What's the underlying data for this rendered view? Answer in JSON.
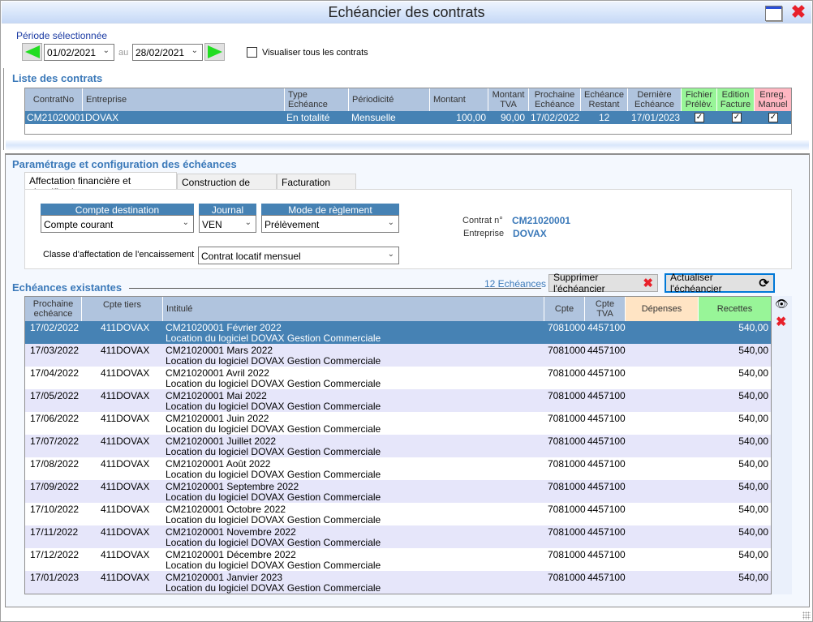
{
  "window": {
    "title": "Echéancier des contrats",
    "restore_icon": "window-restore-icon",
    "close_icon": "close-icon"
  },
  "period": {
    "label": "Période sélectionnée",
    "from": "01/02/2021",
    "to_label": "au",
    "to": "28/02/2021",
    "show_all_label": "Visualiser tous les contrats",
    "show_all_checked": false
  },
  "contracts": {
    "title": "Liste des contrats",
    "columns": [
      "ContratNo",
      "Entreprise",
      "Type Echéance",
      "Périodicité",
      "Montant",
      "Montant TVA",
      "Prochaine Echéance",
      "Echéance Restant",
      "Dernière Echéance",
      "Fichier Prélèv.",
      "Edition Facture",
      "Enreg. Manuel"
    ],
    "column_lines": [
      [
        "ContratNo"
      ],
      [
        "Entreprise"
      ],
      [
        "Type",
        "Echéance"
      ],
      [
        "Périodicité"
      ],
      [
        "Montant"
      ],
      [
        "Montant",
        "TVA"
      ],
      [
        "Prochaine",
        "Echéance"
      ],
      [
        "Echéance",
        "Restant"
      ],
      [
        "Dernière",
        "Echéance"
      ],
      [
        "Fichier",
        "Prélèv."
      ],
      [
        "Edition",
        "Facture"
      ],
      [
        "Enreg.",
        "Manuel"
      ]
    ],
    "rows": [
      {
        "contrat_no": "CM21020001",
        "entreprise": "DOVAX",
        "type_echeance": "En totalité",
        "periodicite": "Mensuelle",
        "montant": "100,00",
        "montant_tva": "90,00",
        "prochaine_echeance": "17/02/2022",
        "echeance_restant": "12",
        "derniere_echeance": "17/01/2023",
        "fichier_prelev": true,
        "edition_facture": true,
        "enreg_manuel": true
      }
    ]
  },
  "config": {
    "title": "Paramétrage et configuration des échéances",
    "tabs": [
      {
        "label": "Affectation financière et classification",
        "active": true
      },
      {
        "label": "Construction de l'intitulé",
        "active": false
      },
      {
        "label": "Facturation horaire",
        "active": false
      }
    ],
    "compte_destination": {
      "label": "Compte destination",
      "value": "Compte courant"
    },
    "journal": {
      "label": "Journal",
      "value": "VEN"
    },
    "mode_reglement": {
      "label": "Mode de règlement",
      "value": "Prélèvement"
    },
    "classe": {
      "label": "Classe d'affectation de l'encaissement",
      "value": "Contrat locatif mensuel"
    },
    "contrat_label": "Contrat n°",
    "contrat_value": "CM21020001",
    "entreprise_label": "Entreprise",
    "entreprise_value": "DOVAX"
  },
  "echeances": {
    "title": "Echéances existantes",
    "count_link": "12 Echéances",
    "delete_button": "Supprimer l'échéancier",
    "refresh_button": "Actualiser l'échéancier",
    "columns": [
      "Prochaine échéance",
      "Cpte tiers",
      "Intitulé",
      "Cpte",
      "Cpte TVA",
      "Dépenses",
      "Recettes"
    ],
    "column_lines": [
      [
        "Prochaine",
        "echéance"
      ],
      [
        "Cpte tiers"
      ],
      [
        "Intitulé"
      ],
      [
        "Cpte"
      ],
      [
        "Cpte",
        "TVA"
      ],
      [
        "Dépenses"
      ],
      [
        "Recettes"
      ]
    ],
    "side_icons": [
      "eye-icon",
      "delete-icon"
    ],
    "rows": [
      {
        "date": "17/02/2022",
        "tiers": "411DOVAX",
        "intitule": "CM21020001 Février 2022",
        "detail": "Location du logiciel DOVAX Gestion Commerciale",
        "cpte": "7081000",
        "cpte_tva": "4457100",
        "depenses": "",
        "recettes": "540,00",
        "selected": true
      },
      {
        "date": "17/03/2022",
        "tiers": "411DOVAX",
        "intitule": "CM21020001 Mars 2022",
        "detail": "Location du logiciel DOVAX Gestion Commerciale",
        "cpte": "7081000",
        "cpte_tva": "4457100",
        "depenses": "",
        "recettes": "540,00"
      },
      {
        "date": "17/04/2022",
        "tiers": "411DOVAX",
        "intitule": "CM21020001 Avril 2022",
        "detail": "Location du logiciel DOVAX Gestion Commerciale",
        "cpte": "7081000",
        "cpte_tva": "4457100",
        "depenses": "",
        "recettes": "540,00"
      },
      {
        "date": "17/05/2022",
        "tiers": "411DOVAX",
        "intitule": "CM21020001 Mai 2022",
        "detail": "Location du logiciel DOVAX Gestion Commerciale",
        "cpte": "7081000",
        "cpte_tva": "4457100",
        "depenses": "",
        "recettes": "540,00"
      },
      {
        "date": "17/06/2022",
        "tiers": "411DOVAX",
        "intitule": "CM21020001 Juin 2022",
        "detail": "Location du logiciel DOVAX Gestion Commerciale",
        "cpte": "7081000",
        "cpte_tva": "4457100",
        "depenses": "",
        "recettes": "540,00"
      },
      {
        "date": "17/07/2022",
        "tiers": "411DOVAX",
        "intitule": "CM21020001 Juillet 2022",
        "detail": "Location du logiciel DOVAX Gestion Commerciale",
        "cpte": "7081000",
        "cpte_tva": "4457100",
        "depenses": "",
        "recettes": "540,00"
      },
      {
        "date": "17/08/2022",
        "tiers": "411DOVAX",
        "intitule": "CM21020001 Août 2022",
        "detail": "Location du logiciel DOVAX Gestion Commerciale",
        "cpte": "7081000",
        "cpte_tva": "4457100",
        "depenses": "",
        "recettes": "540,00"
      },
      {
        "date": "17/09/2022",
        "tiers": "411DOVAX",
        "intitule": "CM21020001 Septembre 2022",
        "detail": "Location du logiciel DOVAX Gestion Commerciale",
        "cpte": "7081000",
        "cpte_tva": "4457100",
        "depenses": "",
        "recettes": "540,00"
      },
      {
        "date": "17/10/2022",
        "tiers": "411DOVAX",
        "intitule": "CM21020001 Octobre 2022",
        "detail": "Location du logiciel DOVAX Gestion Commerciale",
        "cpte": "7081000",
        "cpte_tva": "4457100",
        "depenses": "",
        "recettes": "540,00"
      },
      {
        "date": "17/11/2022",
        "tiers": "411DOVAX",
        "intitule": "CM21020001 Novembre 2022",
        "detail": "Location du logiciel DOVAX Gestion Commerciale",
        "cpte": "7081000",
        "cpte_tva": "4457100",
        "depenses": "",
        "recettes": "540,00"
      },
      {
        "date": "17/12/2022",
        "tiers": "411DOVAX",
        "intitule": "CM21020001 Décembre 2022",
        "detail": "Location du logiciel DOVAX Gestion Commerciale",
        "cpte": "7081000",
        "cpte_tva": "4457100",
        "depenses": "",
        "recettes": "540,00"
      },
      {
        "date": "17/01/2023",
        "tiers": "411DOVAX",
        "intitule": "CM21020001 Janvier 2023",
        "detail": "Location du logiciel DOVAX Gestion Commerciale",
        "cpte": "7081000",
        "cpte_tva": "4457100",
        "depenses": "",
        "recettes": "540,00"
      }
    ]
  },
  "colors": {
    "accent_blue": "#4682b4",
    "header_blue": "#b0c4de",
    "title_blue": "#3b79b9",
    "green_header": "#98f598",
    "pink_header": "#ffb6c1",
    "peach_header": "#ffe4c4",
    "alt_row": "#e6e6fa",
    "nav_arrow": "#22dd22",
    "close_red": "#e8202a"
  }
}
